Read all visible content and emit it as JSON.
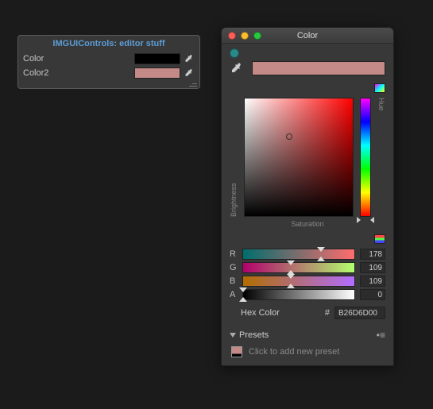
{
  "inspector": {
    "title": "IMGUIControls: editor stuff",
    "rows": [
      {
        "label": "Color"
      },
      {
        "label": "Color2"
      }
    ]
  },
  "picker": {
    "window_title": "Color",
    "axes": {
      "brightness": "Brightness",
      "saturation": "Saturation",
      "hue": "Hue"
    },
    "sliders": {
      "r": {
        "label": "R",
        "value": "178",
        "pct": 69.8
      },
      "g": {
        "label": "G",
        "value": "109",
        "pct": 42.7
      },
      "b": {
        "label": "B",
        "value": "109",
        "pct": 42.7
      },
      "a": {
        "label": "A",
        "value": "0",
        "pct": 0
      }
    },
    "hex": {
      "label": "Hex Color",
      "hash": "#",
      "value": "B26D6D00"
    },
    "presets": {
      "header": "Presets",
      "hint": "Click to add new preset"
    },
    "selected_color": "#c38a87"
  }
}
